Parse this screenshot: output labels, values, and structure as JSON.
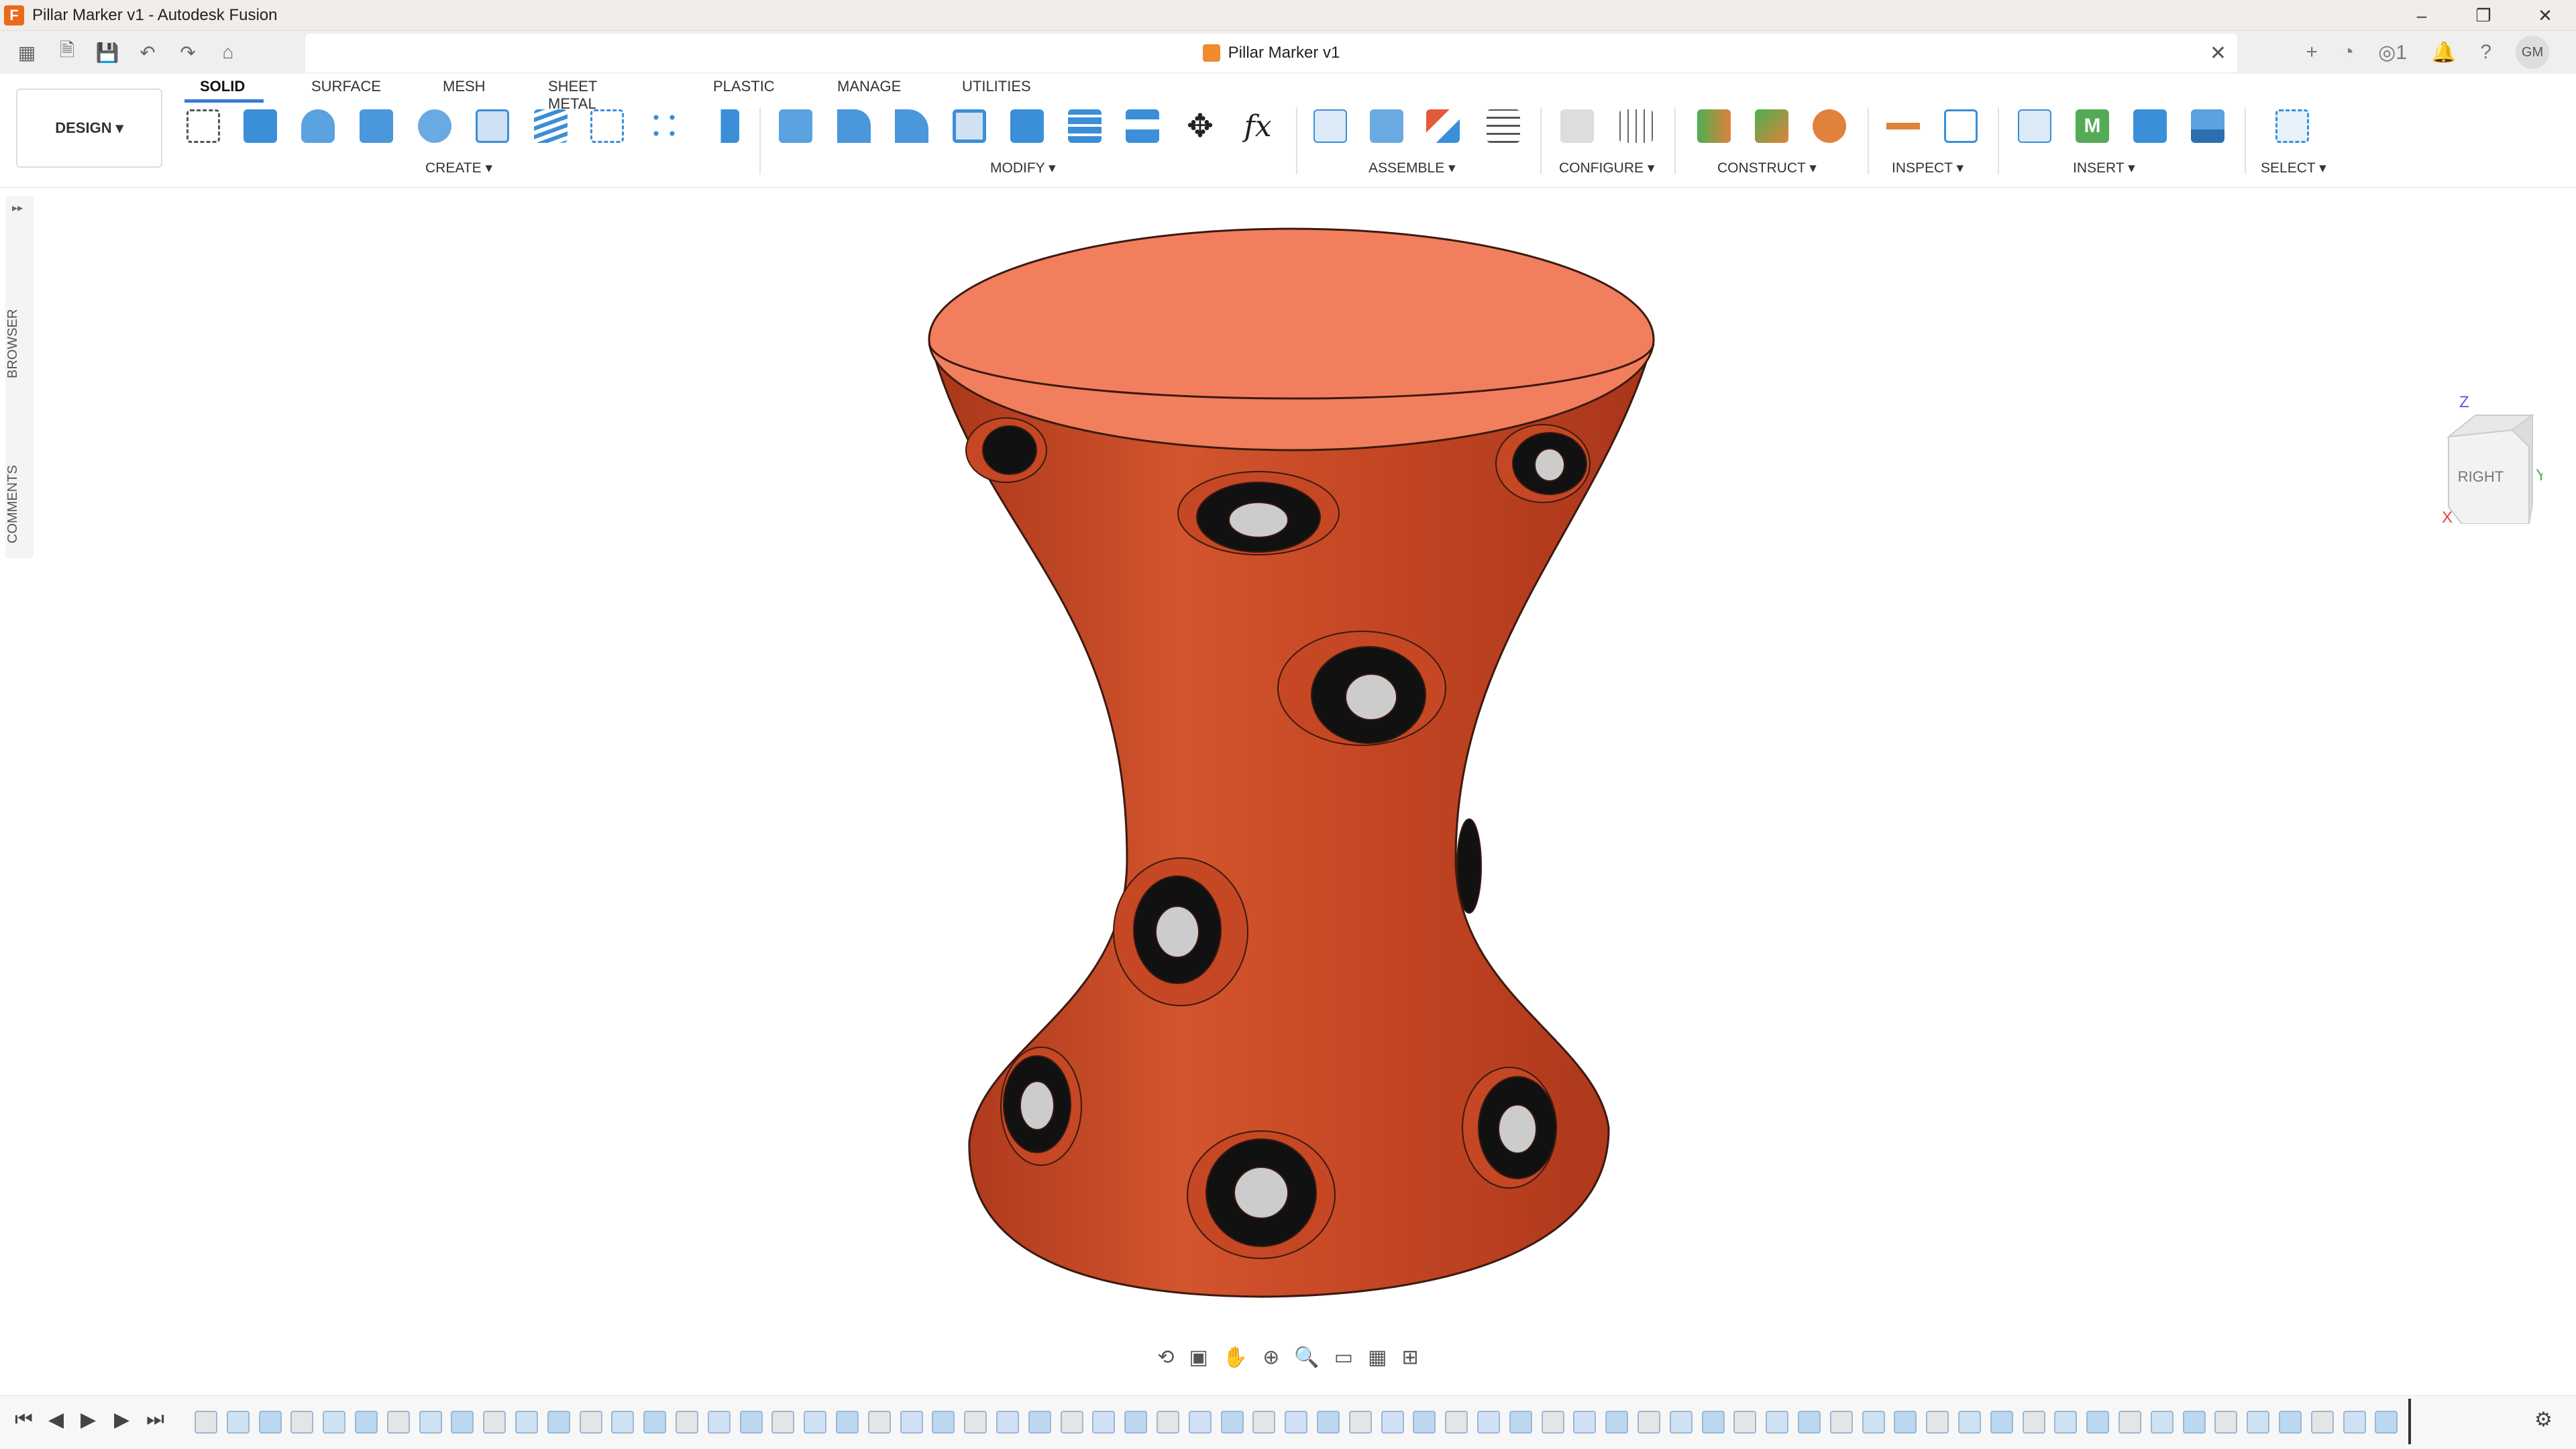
{
  "window": {
    "title": "Pillar Marker v1 - Autodesk Fusion",
    "logo": "F"
  },
  "window_controls": {
    "minimize": "–",
    "maximize": "❐",
    "close": "✕"
  },
  "doc_tab": {
    "name": "Pillar Marker v1",
    "close": "✕"
  },
  "qa_right": {
    "plus": "+",
    "online": "◔",
    "jobs": "1",
    "bell": "🔔",
    "help": "?",
    "avatar": "GM"
  },
  "design_button": {
    "label": "DESIGN ▾"
  },
  "tabs": [
    "SOLID",
    "SURFACE",
    "MESH",
    "SHEET METAL",
    "PLASTIC",
    "MANAGE",
    "UTILITIES"
  ],
  "groups": {
    "create": "CREATE ▾",
    "modify": "MODIFY ▾",
    "assemble": "ASSEMBLE ▾",
    "configure": "CONFIGURE ▾",
    "construct": "CONSTRUCT ▾",
    "inspect": "INSPECT ▾",
    "insert": "INSERT ▾",
    "select": "SELECT ▾"
  },
  "sidebar": {
    "expand": "▸▸",
    "browser": "BROWSER",
    "comments": "COMMENTS"
  },
  "viewcube": {
    "face": "RIGHT",
    "axis_z": "Z",
    "axis_y": "Y",
    "axis_x": "X"
  },
  "colors": {
    "model": "#c0431f",
    "model_top": "#f17f5d",
    "accent": "#3a7bd5"
  }
}
